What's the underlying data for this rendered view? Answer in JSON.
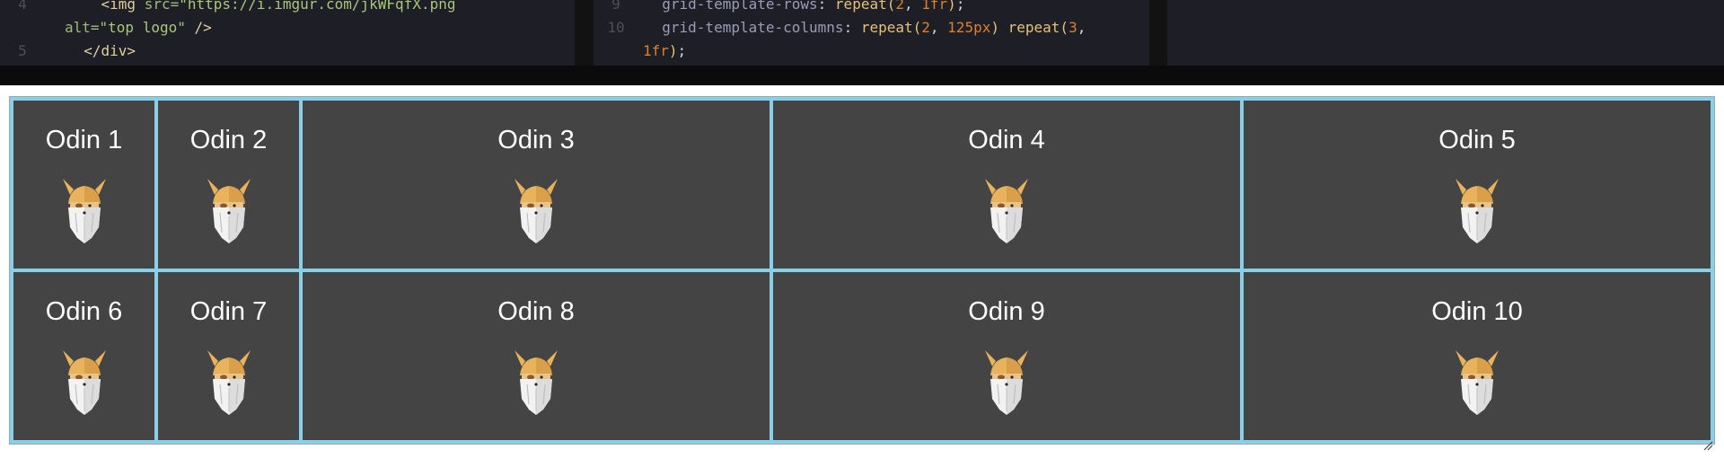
{
  "editor": {
    "html_lines": [
      {
        "num": "4",
        "parts": [
          [
            "tok-tag",
            "    <img "
          ],
          [
            "tok-attr",
            "src="
          ],
          [
            "tok-str",
            "\"https://i.imgur.com/jkWFqfX.png"
          ]
        ]
      },
      {
        "num": "",
        "parts": [
          [
            "tok-attr",
            "alt="
          ],
          [
            "tok-str",
            "\"top logo\""
          ],
          [
            "tok-tag",
            " />"
          ]
        ]
      },
      {
        "num": "5",
        "parts": [
          [
            "tok-tag",
            "  </div>"
          ]
        ]
      }
    ],
    "css_lines": [
      {
        "num": "9",
        "parts": [
          [
            "tok-prop",
            "  grid-template-rows"
          ],
          [
            "tok-plain",
            ": "
          ],
          [
            "tok-fn",
            "repeat("
          ],
          [
            "tok-num",
            "2"
          ],
          [
            "tok-plain",
            ", "
          ],
          [
            "tok-num",
            "1fr"
          ],
          [
            "tok-fn",
            ")"
          ],
          [
            "tok-plain",
            ";"
          ]
        ]
      },
      {
        "num": "10",
        "parts": [
          [
            "tok-prop",
            "  grid-template-columns"
          ],
          [
            "tok-plain",
            ": "
          ],
          [
            "tok-fn",
            "repeat("
          ],
          [
            "tok-num",
            "2"
          ],
          [
            "tok-plain",
            ", "
          ],
          [
            "tok-num",
            "125px"
          ],
          [
            "tok-fn",
            ")"
          ],
          [
            "tok-plain",
            " "
          ],
          [
            "tok-fn",
            "repeat("
          ],
          [
            "tok-num",
            "3"
          ],
          [
            "tok-plain",
            ","
          ]
        ]
      },
      {
        "num": "",
        "parts": [
          [
            "tok-num",
            "1fr"
          ],
          [
            "tok-fn",
            ")"
          ],
          [
            "tok-plain",
            ";"
          ]
        ]
      }
    ]
  },
  "preview": {
    "cells": [
      {
        "label": "Odin 1"
      },
      {
        "label": "Odin 2"
      },
      {
        "label": "Odin 3"
      },
      {
        "label": "Odin 4"
      },
      {
        "label": "Odin 5"
      },
      {
        "label": "Odin 6"
      },
      {
        "label": "Odin 7"
      },
      {
        "label": "Odin 8"
      },
      {
        "label": "Odin 9"
      },
      {
        "label": "Odin 10"
      }
    ],
    "cell_image_alt": "odin logo"
  },
  "colors": {
    "grid_background": "#88cfe8",
    "cell_background": "#444444",
    "cell_text": "#ffffff",
    "editor_background": "#1e1f26"
  },
  "icons": {
    "cell_image": "odin-viking-head-icon",
    "resize": "resize-grip-icon"
  }
}
